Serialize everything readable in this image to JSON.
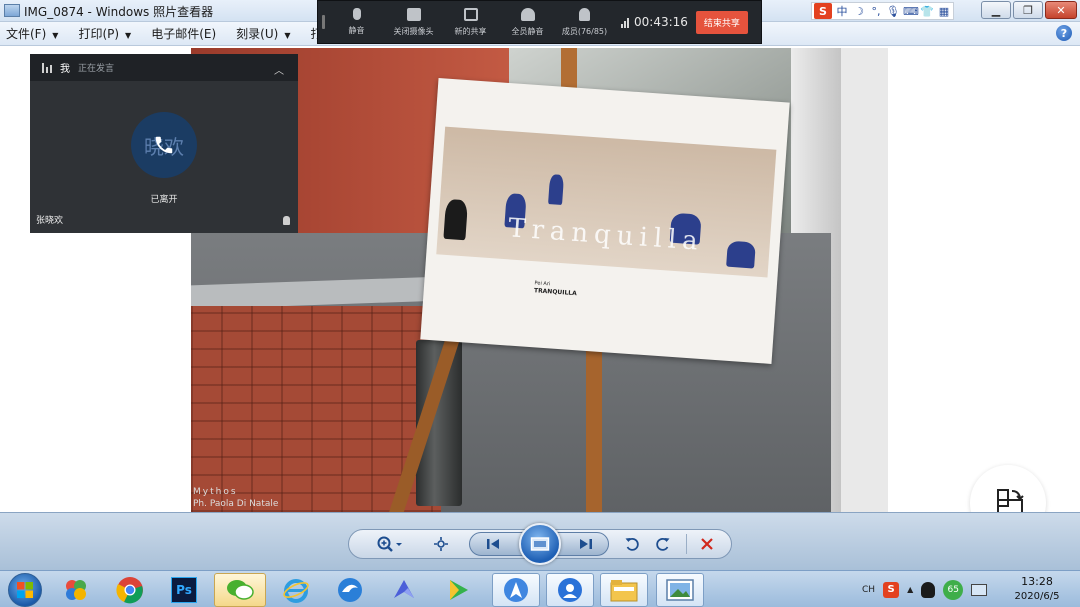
{
  "window": {
    "title": "IMG_0874 - Windows 照片查看器",
    "minimize_symbol": "▁",
    "restore_symbol": "❐",
    "close_symbol": "✕"
  },
  "ime": {
    "logo": "S",
    "mode": "中",
    "icons": [
      "moon-icon",
      "punctuation-icon",
      "microphone-icon",
      "keyboard-icon",
      "shirt-icon",
      "grid-icon"
    ]
  },
  "menu": {
    "items": [
      {
        "label": "文件(F)",
        "has_arrow": true
      },
      {
        "label": "打印(P)",
        "has_arrow": true
      },
      {
        "label": "电子邮件(E)",
        "has_arrow": false
      },
      {
        "label": "刻录(U)",
        "has_arrow": true
      },
      {
        "label": "打开",
        "has_arrow": false
      }
    ],
    "help_symbol": "?"
  },
  "meeting": {
    "tools": [
      {
        "label": "静音",
        "icon": "microphone-icon"
      },
      {
        "label": "关闭摄像头",
        "icon": "camera-icon"
      },
      {
        "label": "新的共享",
        "icon": "screen-share-icon"
      },
      {
        "label": "全员静音",
        "icon": "mute-all-icon"
      },
      {
        "label": "成员(76/85)",
        "icon": "members-icon"
      }
    ],
    "timer": "00:43:16",
    "end_share_label": "结束共享"
  },
  "speaker_panel": {
    "me_label": "我",
    "status": "正在发言",
    "avatar_text": "晓欢",
    "left_status": "已离开",
    "participant_name": "张晓欢"
  },
  "photo": {
    "poster_title": "Tranquilla",
    "poster_subtitle": "Pei Ari",
    "poster_name": "TRANQUILLA",
    "credit_line1": "Mythos",
    "credit_line2": "Ph. Paola Di Natale"
  },
  "taskbar": {
    "apps": [
      "windows-start-icon",
      "app-folder-icon",
      "chrome-icon",
      "photoshop-icon",
      "wechat-icon",
      "ie-icon",
      "browser-icon",
      "feishu-icon",
      "media-player-icon",
      "maps-icon",
      "call-icon",
      "explorer-icon",
      "photo-viewer-icon"
    ],
    "photoshop_label": "Ps",
    "ime_tray_label": "CH",
    "badge_count": "65",
    "time": "13:28",
    "date": "2020/6/5"
  },
  "colors": {
    "accent": "#1e5fb4",
    "end_share": "#e5533d",
    "meeting_bar": "#23272c",
    "speaker_panel": "#2f3236"
  }
}
